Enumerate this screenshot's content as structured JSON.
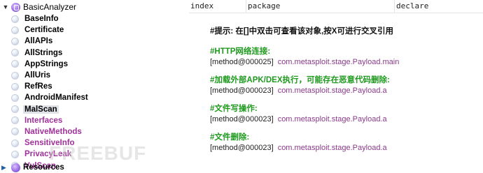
{
  "tree": {
    "root": {
      "toggle": "▼",
      "label": "BasicAnalyzer"
    },
    "items": [
      {
        "label": "BaseInfo",
        "color": "#000000"
      },
      {
        "label": "Certificate",
        "color": "#000000"
      },
      {
        "label": "AllAPIs",
        "color": "#000000"
      },
      {
        "label": "AllStrings",
        "color": "#000000"
      },
      {
        "label": "AppStrings",
        "color": "#000000"
      },
      {
        "label": "AllUris",
        "color": "#000000"
      },
      {
        "label": "RefRes",
        "color": "#000000"
      },
      {
        "label": "AndroidManifest",
        "color": "#000000"
      },
      {
        "label": "MalScan",
        "color": "#000000",
        "selected": true
      },
      {
        "label": "Interfaces",
        "color": "#a0309a"
      },
      {
        "label": "NativeMethods",
        "color": "#a0309a"
      },
      {
        "label": "SensitiveInfo",
        "color": "#a0309a"
      },
      {
        "label": "PrivacyLeak",
        "color": "#a0309a"
      },
      {
        "label": "VulScan",
        "color": "#a0309a"
      }
    ],
    "bottom": {
      "toggle": "▶",
      "label": "Resources"
    },
    "watermark": "FREEBUF"
  },
  "header": {
    "columns": [
      "index",
      "package",
      "declare"
    ]
  },
  "content": {
    "hint": "#提示: 在[]中双击可查看该对象,按X可进行交叉引用",
    "sections": [
      {
        "title": "#HTTP网络连接:",
        "method": "[method@000025]",
        "class": "com.metasploit.stage.Payload.main"
      },
      {
        "title": "#加载外部APK/DEX执行，可能存在恶意代码删除:",
        "method": "[method@000023]",
        "class": "com.metasploit.stage.Payload.a"
      },
      {
        "title": "#文件写操作:",
        "method": "[method@000023]",
        "class": "com.metasploit.stage.Payload.a"
      },
      {
        "title": "#文件删除:",
        "method": "[method@000023]",
        "class": "com.metasploit.stage.Payload.a"
      }
    ]
  },
  "colors": {
    "section_title": "#1e9a1e",
    "class_link": "#8a3a8a",
    "tree_purple": "#a0309a"
  }
}
